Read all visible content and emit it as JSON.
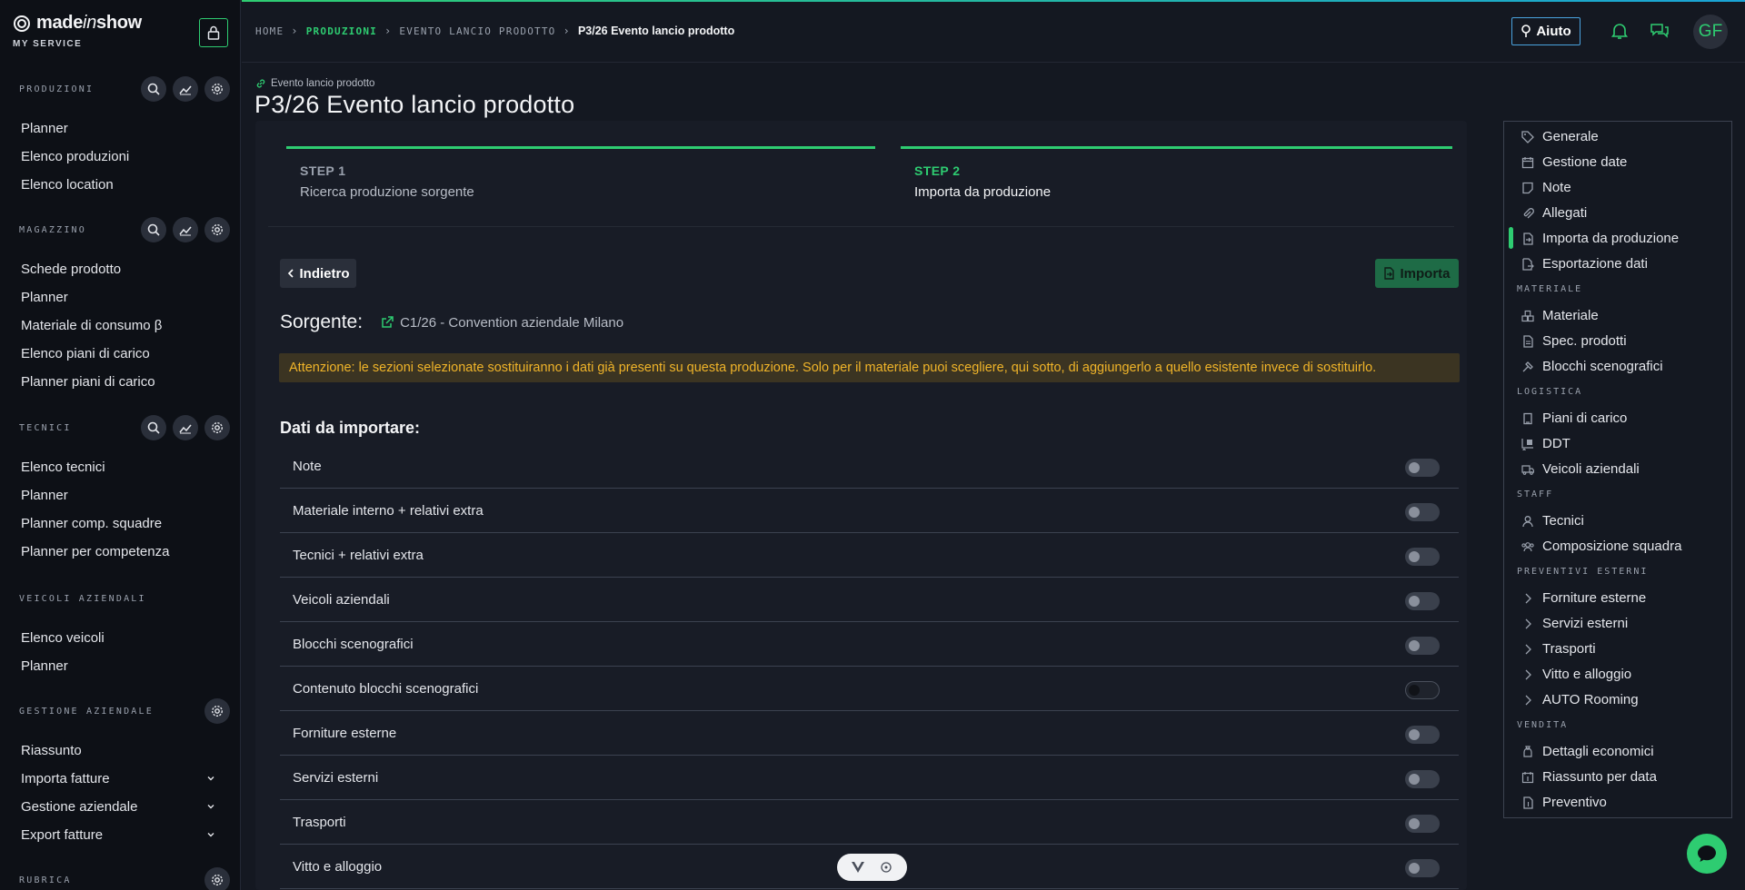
{
  "brand": {
    "name_pre": "made",
    "name_italic": "in",
    "name_post": "show",
    "sub": "MY SERVICE"
  },
  "sidebar": {
    "sections": [
      {
        "label": "PRODUZIONI",
        "items": [
          "Planner",
          "Elenco produzioni",
          "Elenco location"
        ]
      },
      {
        "label": "MAGAZZINO",
        "items": [
          "Schede prodotto",
          "Planner",
          "Materiale di consumo β",
          "Elenco piani di carico",
          "Planner piani di carico"
        ]
      },
      {
        "label": "TECNICI",
        "items": [
          "Elenco tecnici",
          "Planner",
          "Planner comp. squadre",
          "Planner per competenza"
        ]
      },
      {
        "label": "VEICOLI AZIENDALI",
        "items": [
          "Elenco veicoli",
          "Planner"
        ]
      },
      {
        "label": "GESTIONE AZIENDALE",
        "items": [
          "Riassunto",
          "Importa fatture",
          "Gestione aziendale",
          "Export fatture"
        ]
      },
      {
        "label": "RUBRICA",
        "items": []
      }
    ]
  },
  "breadcrumb": {
    "home": "HOME",
    "produzioni": "PRODUZIONI",
    "evento": "EVENTO LANCIO PRODOTTO",
    "current": "P3/26 Evento lancio prodotto"
  },
  "topbar": {
    "help_label": "Aiuto",
    "avatar_initials": "GF"
  },
  "page": {
    "sup": "Evento lancio prodotto",
    "title": "P3/26 Evento lancio prodotto"
  },
  "steps": [
    {
      "label": "STEP 1",
      "desc": "Ricerca produzione sorgente"
    },
    {
      "label": "STEP 2",
      "desc": "Importa da produzione"
    }
  ],
  "actions": {
    "back_label": "Indietro",
    "import_label": "Importa"
  },
  "source": {
    "label": "Sorgente:",
    "link": "C1/26 - Convention aziendale Milano"
  },
  "warning": "Attenzione: le sezioni selezionate sostituiranno i dati già presenti su questa produzione. Solo per il materiale puoi scegliere, qui sotto, di aggiungerlo a quello esistente invece di sostituirlo.",
  "data_title": "Dati da importare:",
  "import_rows": [
    {
      "label": "Note",
      "on": false
    },
    {
      "label": "Materiale interno + relativi extra",
      "on": false
    },
    {
      "label": "Tecnici + relativi extra",
      "on": false
    },
    {
      "label": "Veicoli aziendali",
      "on": false
    },
    {
      "label": "Blocchi scenografici",
      "on": false
    },
    {
      "label": "Contenuto blocchi scenografici",
      "on": false
    },
    {
      "label": "Forniture esterne",
      "on": false
    },
    {
      "label": "Servizi esterni",
      "on": false
    },
    {
      "label": "Trasporti",
      "on": false
    },
    {
      "label": "Vitto e alloggio",
      "on": false
    }
  ],
  "rightnav": {
    "general": [
      "Generale",
      "Gestione date",
      "Note",
      "Allegati",
      "Importa da produzione",
      "Esportazione dati"
    ],
    "materiale_head": "MATERIALE",
    "materiale": [
      "Materiale",
      "Spec. prodotti",
      "Blocchi scenografici"
    ],
    "logistica_head": "LOGISTICA",
    "logistica": [
      "Piani di carico",
      "DDT",
      "Veicoli aziendali"
    ],
    "staff_head": "STAFF",
    "staff": [
      "Tecnici",
      "Composizione squadra"
    ],
    "preventivi_head": "PREVENTIVI ESTERNI",
    "preventivi": [
      "Forniture esterne",
      "Servizi esterni",
      "Trasporti",
      "Vitto e alloggio",
      "AUTO Rooming"
    ],
    "vendita_head": "VENDITA",
    "vendita": [
      "Dettagli economici",
      "Riassunto per data",
      "Preventivo"
    ]
  },
  "colors": {
    "accent": "#2ecc71",
    "warning_text": "#f0b429",
    "warning_bg": "#3b3422"
  }
}
